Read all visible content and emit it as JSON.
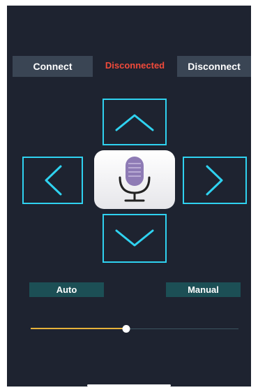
{
  "header": {
    "connect_label": "Connect",
    "status_text": "Disconnected",
    "disconnect_label": "Disconnect"
  },
  "dpad": {
    "up_icon": "chevron-up-icon",
    "down_icon": "chevron-down-icon",
    "left_icon": "chevron-left-icon",
    "right_icon": "chevron-right-icon",
    "color": "#2fd2f0"
  },
  "mic": {
    "icon": "microphone-icon",
    "color": "#8e7bb5"
  },
  "modes": {
    "auto_label": "Auto",
    "manual_label": "Manual"
  },
  "slider": {
    "value": 0.46,
    "fill_color": "#e6b23a"
  },
  "colors": {
    "background": "#1e2330",
    "status": "#f14a3a",
    "button": "#3a4554",
    "mode_button": "#1c4f55"
  }
}
